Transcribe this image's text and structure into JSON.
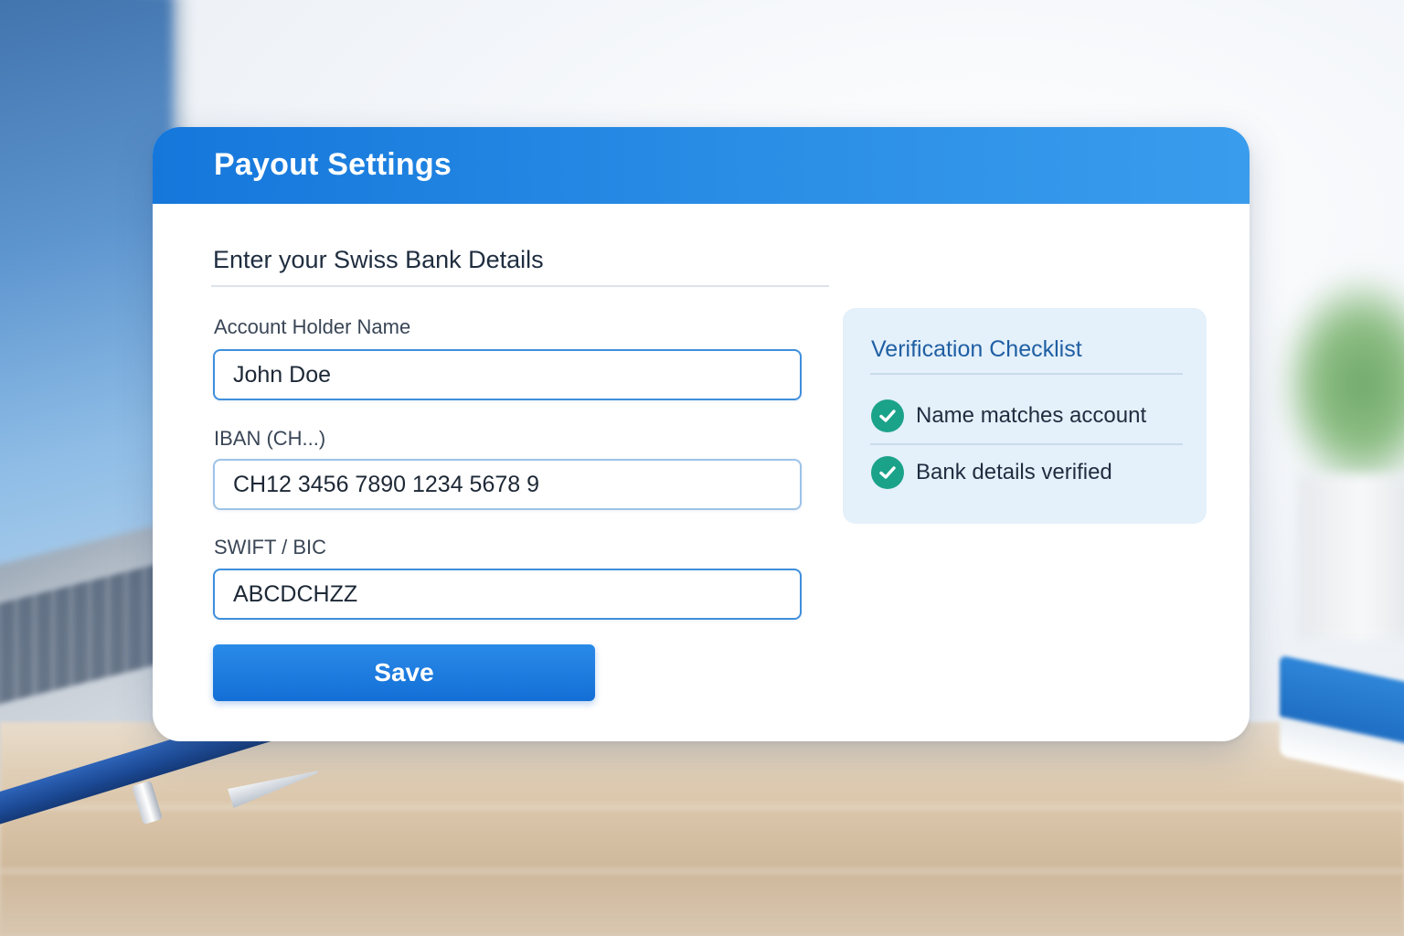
{
  "window": {
    "title": "Payout Settings"
  },
  "form": {
    "section_title": "Enter your Swiss Bank Details",
    "fields": [
      {
        "label": "Account Holder Name",
        "value": "John Doe"
      },
      {
        "label": "IBAN (CH...)",
        "value": "CH12 3456 7890 1234 5678 9"
      },
      {
        "label": "SWIFT / BIC",
        "value": "ABCDCHZZ"
      }
    ],
    "save_label": "Save"
  },
  "checklist": {
    "title": "Verification Checklist",
    "items": [
      {
        "label": "Name matches account",
        "status": "checked",
        "icon": "check-circle-icon"
      },
      {
        "label": "Bank details verified",
        "status": "checked",
        "icon": "check-circle-icon"
      }
    ]
  },
  "colors": {
    "header_blue": "#1577db",
    "button_blue": "#136fd6",
    "check_green": "#1ba38a",
    "panel_bg": "#e4f0fa"
  }
}
